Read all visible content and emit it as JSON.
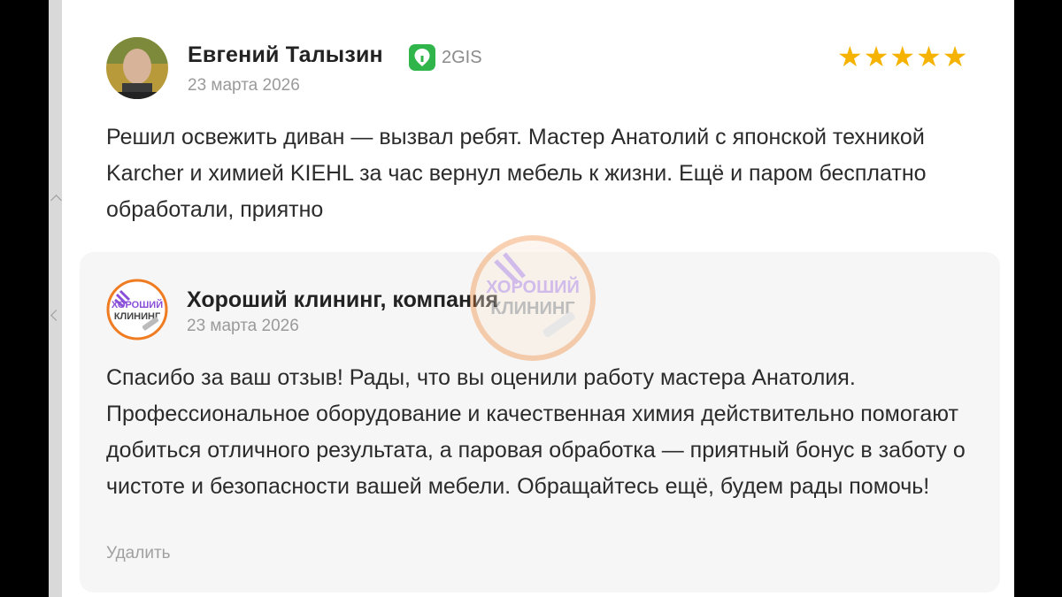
{
  "review": {
    "author": "Евгений Талызин",
    "source": "2GIS",
    "date": "23 марта 2026",
    "rating": 5,
    "text": "Решил освежить диван — вызвал ребят. Мастер Анатолий с японской техникой Karcher и химией KIEHL за час вернул мебель к жизни. Ещё и паром бесплатно обработали, приятно"
  },
  "reply": {
    "author": "Хороший клининг, компания",
    "date": "23 марта 2026",
    "logo_text_top": "ХОРОШИЙ",
    "logo_text_bottom": "КЛИНИНГ",
    "text": "Спасибо за ваш отзыв! Рады, что вы оценили работу мастера Анатолия. Профессиональное оборудование и качественная химия действительно помогают добиться отличного результата, а паровая обработка — приятный бонус в заботу о чистоте и безопасности вашей мебели. Обращайтесь ещё, будем рады помочь!",
    "delete_label": "Удалить"
  },
  "watermark": {
    "text_top": "ХОРОШИЙ",
    "text_bottom": "КЛИНИНГ"
  },
  "colors": {
    "star": "#f5b300",
    "source_green": "#2fb54a",
    "logo_orange": "#f07c22",
    "logo_purple": "#8a4fd8"
  },
  "icons": {
    "source": "2gis-pin-icon",
    "star": "star-icon"
  }
}
